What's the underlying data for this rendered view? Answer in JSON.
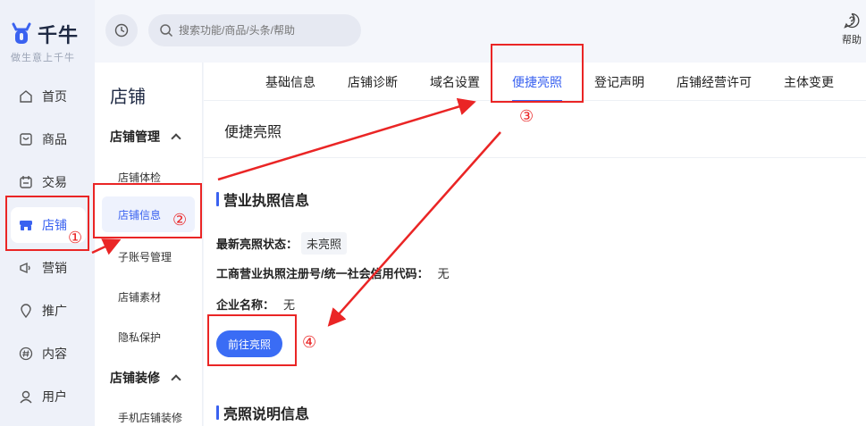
{
  "brand": {
    "name": "千牛",
    "tagline": "做生意上千牛",
    "accent_color": "#3a62f0"
  },
  "rail": {
    "items": [
      {
        "label": "首页",
        "icon": "home-icon"
      },
      {
        "label": "商品",
        "icon": "goods-icon"
      },
      {
        "label": "交易",
        "icon": "trade-icon"
      },
      {
        "label": "店铺",
        "icon": "store-icon",
        "active": true
      },
      {
        "label": "营销",
        "icon": "megaphone-icon"
      },
      {
        "label": "推广",
        "icon": "location-pin-icon"
      },
      {
        "label": "内容",
        "icon": "hash-icon"
      },
      {
        "label": "用户",
        "icon": "user-icon"
      }
    ]
  },
  "subnav": {
    "title": "店铺",
    "groups": [
      {
        "label": "店铺管理",
        "items": [
          "店铺体检",
          "店铺信息",
          "子账号管理",
          "店铺素材",
          "隐私保护"
        ]
      },
      {
        "label": "店铺装修",
        "items": [
          "手机店铺装修"
        ]
      }
    ],
    "active_item": "店铺信息"
  },
  "topbar": {
    "search_placeholder": "搜索功能/商品/头条/帮助",
    "help_label": "帮助"
  },
  "tabs": [
    "基础信息",
    "店铺诊断",
    "域名设置",
    "便捷亮照",
    "登记声明",
    "店铺经营许可",
    "主体变更"
  ],
  "active_tab": "便捷亮照",
  "page": {
    "title": "便捷亮照",
    "section1_title": "营业执照信息",
    "status_label": "最新亮照状态：",
    "status_value": "未亮照",
    "reg_no_label": "工商营业执照注册号/统一社会信用代码：",
    "reg_no_value": "无",
    "company_label": "企业名称：",
    "company_value": "无",
    "go_button": "前往亮照",
    "section2_title": "亮照说明信息"
  },
  "annotations": {
    "step1": "①",
    "step2": "②",
    "step3": "③",
    "step4": "④",
    "color": "#ea2525"
  }
}
